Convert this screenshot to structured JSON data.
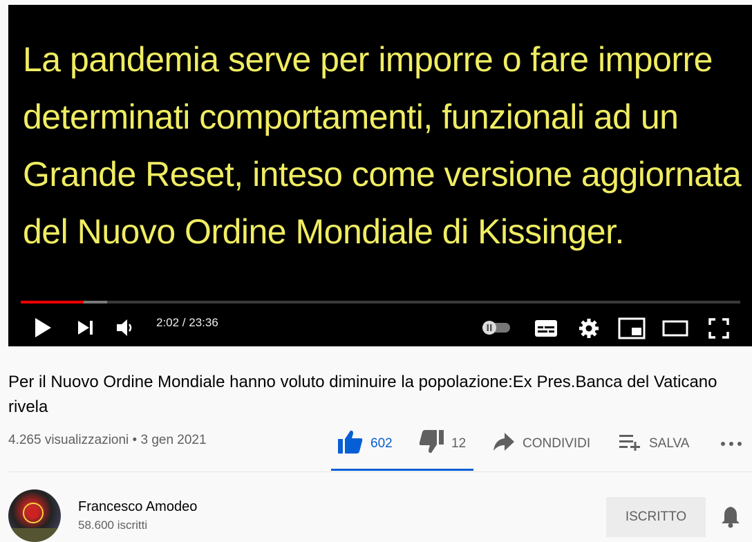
{
  "video": {
    "subtitle_text": "La pandemia serve per imporre o fare imporre\ndeterminati comportamenti, funzionali ad un\nGrande Reset, inteso come versione aggiornata\ndel Nuovo Ordine Mondiale di Kissinger.",
    "time_display": "2:02 / 23:36",
    "progress": {
      "played_fraction": 0.087,
      "buffered_fraction": 0.12
    },
    "controls": [
      "play-icon",
      "next-icon",
      "volume-icon",
      "autoplay-toggle",
      "subtitles-icon",
      "gear-icon",
      "miniplayer-icon",
      "theater-icon",
      "fullscreen-icon"
    ]
  },
  "title": "Per il Nuovo Ordine Mondiale hanno voluto diminuire la popolazione:Ex Pres.Banca del Vaticano rivela",
  "meta": {
    "views_date": "4.265 visualizzazioni • 3 gen 2021"
  },
  "actions": {
    "like_count": "602",
    "dislike_count": "12",
    "share_label": "CONDIVIDI",
    "save_label": "SALVA"
  },
  "channel": {
    "name": "Francesco Amodeo",
    "subscribers": "58.600 iscritti",
    "subscribe_label": "ISCRITTO"
  },
  "colors": {
    "subtitle": "#f0ed62",
    "progress": "#ee0000",
    "like": "#065fd4"
  }
}
